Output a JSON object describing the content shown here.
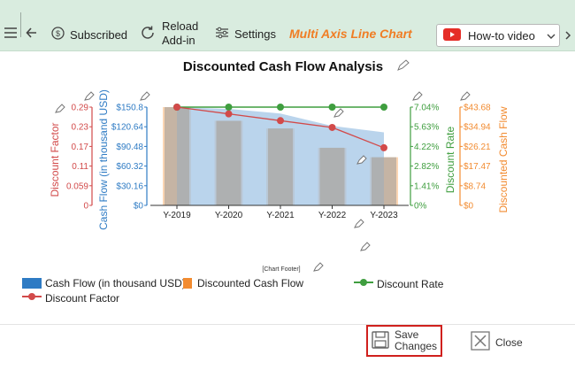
{
  "toolbar": {
    "subscribed_label": "Subscribed",
    "reload_label_1": "Reload",
    "reload_label_2": "Add-in",
    "settings_label": "Settings",
    "brand": "Multi Axis Line Chart",
    "howto_label": "How-to video"
  },
  "chart_footer": "[Chart Footer]",
  "chart_data": {
    "type": "line",
    "title": "Discounted Cash Flow Analysis",
    "categories": [
      "Y-2019",
      "Y-2020",
      "Y-2021",
      "Y-2022",
      "Y-2023"
    ],
    "series": [
      {
        "name": "Cash Flow (in thousand USD)",
        "type": "area",
        "axis_title": "Cash Flow (in thousand USD)",
        "values": [
          150.8,
          148,
          141,
          122,
          112
        ],
        "ticks": [
          "$0",
          "$30.16",
          "$60.32",
          "$90.48",
          "$120.64",
          "$150.8"
        ],
        "max": 150.8,
        "color": "#2e7bc4"
      },
      {
        "name": "Discounted Cash Flow",
        "type": "bar",
        "axis_title": "Discounted Cash Flow",
        "values": [
          43.68,
          37.6,
          34.2,
          25.6,
          21.4
        ],
        "ticks": [
          "$0",
          "$8.74",
          "$17.47",
          "$26.21",
          "$34.94",
          "$43.68"
        ],
        "max": 43.68,
        "color": "#f28b30"
      },
      {
        "name": "Discount Rate",
        "type": "line",
        "axis_title": "Discount Rate",
        "values": [
          7.04,
          7.04,
          7.04,
          7.04,
          7.04
        ],
        "ticks": [
          "0%",
          "1.41%",
          "2.82%",
          "4.22%",
          "5.63%",
          "7.04%"
        ],
        "max": 7.04,
        "color": "#3f9e3f"
      },
      {
        "name": "Discount Factor",
        "type": "line",
        "axis_title": "Discount Factor",
        "values": [
          0.29,
          0.27,
          0.25,
          0.23,
          0.17
        ],
        "ticks": [
          "0",
          "0.059",
          "0.11",
          "0.17",
          "0.23",
          "0.29"
        ],
        "max": 0.29,
        "color": "#d24a4a"
      }
    ],
    "legend_position": "bottom-left",
    "grid": false
  },
  "buttons": {
    "save_1": "Save",
    "save_2": "Changes",
    "close": "Close"
  },
  "colors": {
    "toolbar_bg": "#d9ecdf",
    "brand": "#f07d24",
    "highlight": "#d0201d"
  }
}
